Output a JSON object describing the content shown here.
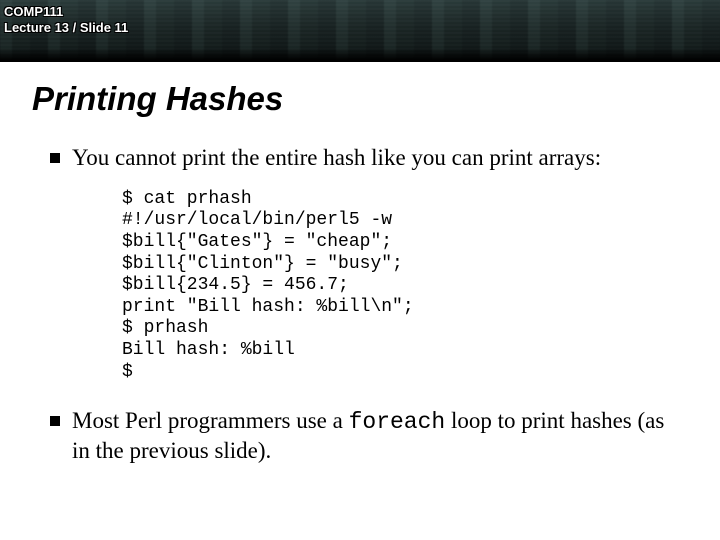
{
  "header": {
    "course": "COMP111",
    "location": "Lecture 13 / Slide 11"
  },
  "title": "Printing Hashes",
  "bullets": [
    {
      "text": "You cannot print the entire hash like you can print arrays:"
    },
    {
      "pre": "Most Perl programmers use a ",
      "code": "foreach",
      "post": " loop to print hashes (as in the previous slide)."
    }
  ],
  "code": "$ cat prhash\n#!/usr/local/bin/perl5 -w\n$bill{\"Gates\"} = \"cheap\";\n$bill{\"Clinton\"} = \"busy\";\n$bill{234.5} = 456.7;\nprint \"Bill hash: %bill\\n\";\n$ prhash\nBill hash: %bill\n$"
}
